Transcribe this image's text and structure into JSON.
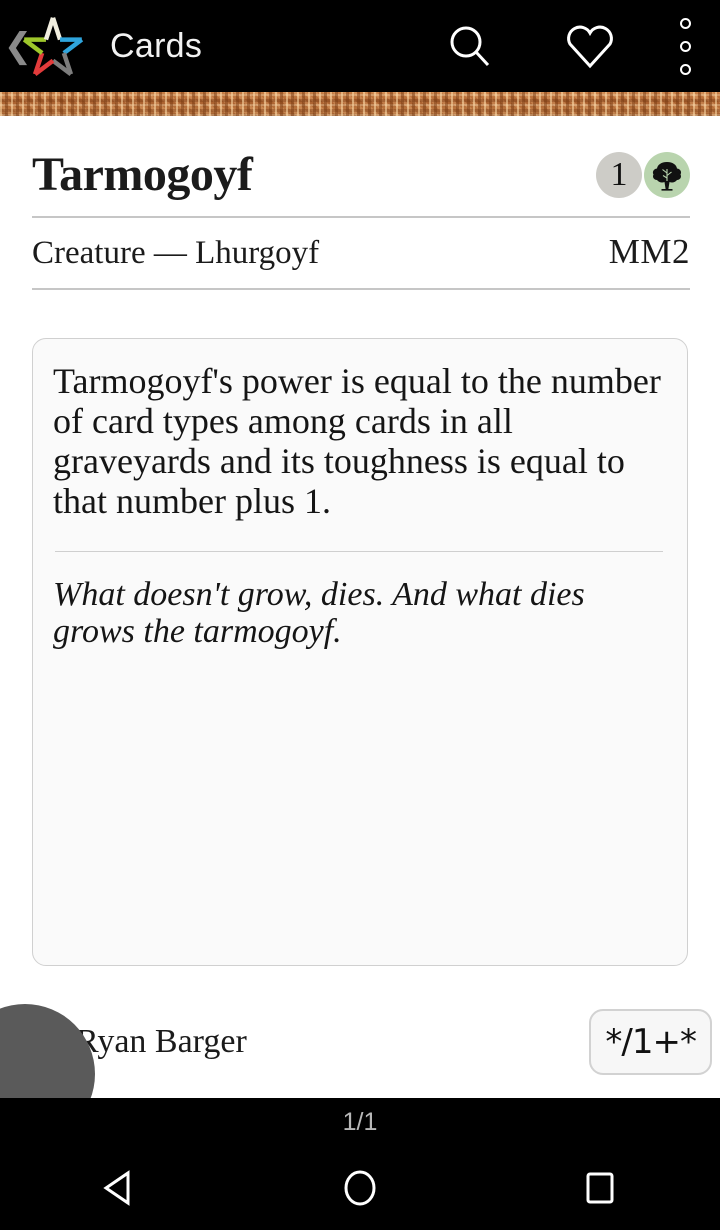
{
  "appbar": {
    "back_icon": "back-chevron-icon",
    "logo_icon": "mtg-star-logo",
    "title": "Cards",
    "search_icon": "search-icon",
    "favorite_icon": "heart-icon",
    "overflow_icon": "more-vertical-icon"
  },
  "card": {
    "name": "Tarmogoyf",
    "mana_cost": {
      "generic": "1",
      "color_symbol": "green-tree-mana-icon"
    },
    "type_line": "Creature — Lhurgoyf",
    "set_code": "MM2",
    "rules_text": "Tarmogoyf's power is equal to the number of card types among cards in all graveyards and its toughness is equal to that number plus 1.",
    "flavor_text": "What doesn't grow, dies. And what dies grows the tarmogoyf.",
    "artist": "Ryan Barger",
    "power_toughness": "*/1+*"
  },
  "footer": {
    "page_indicator": "1/1"
  },
  "navbar": {
    "back_icon": "android-back-icon",
    "home_icon": "android-home-icon",
    "recents_icon": "android-recents-icon"
  },
  "colors": {
    "appbar_bg": "#000000",
    "set_strip": "#b06a33",
    "mana_generic_bg": "#cdccc7",
    "mana_green_bg": "#b9d4ae",
    "text_box_bg": "#fafafa",
    "fab": "#5a5a5a"
  }
}
